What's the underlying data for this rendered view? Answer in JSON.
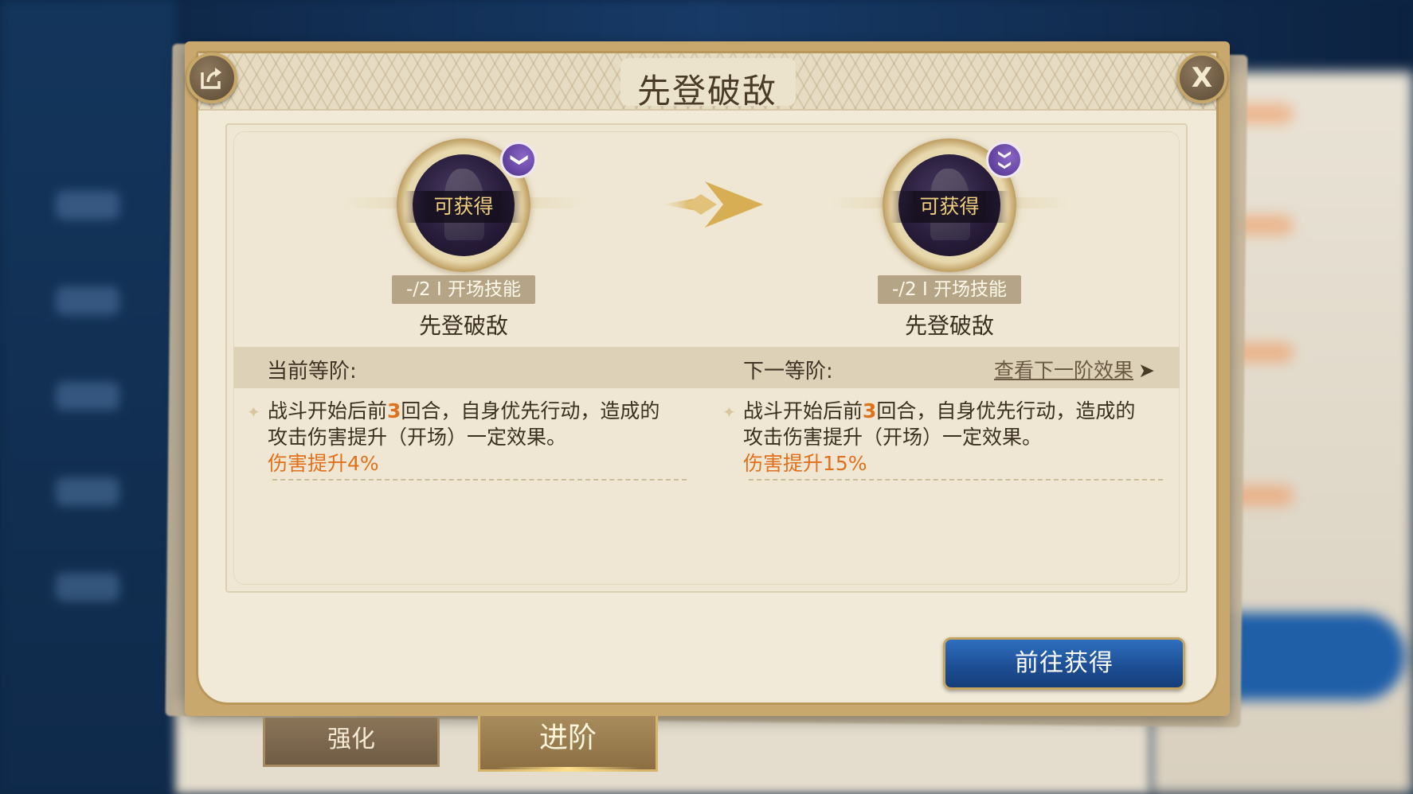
{
  "dialog": {
    "title": "先登破敌",
    "close_label": "X"
  },
  "icons": {
    "share": "share-icon",
    "close": "close-icon",
    "badge_single": "chevron-down-icon",
    "badge_double": "double-chevron-down-icon",
    "arrow": "arrow-right-icon"
  },
  "current_skill": {
    "status": "可获得",
    "badge": "❯",
    "tag": "-/2 I 开场技能",
    "name": "先登破敌"
  },
  "next_skill": {
    "status": "可获得",
    "badge": "❯❯",
    "tag": "-/2 I 开场技能",
    "name": "先登破敌"
  },
  "stage": {
    "current_label": "当前等阶:",
    "next_label": "下一等阶:",
    "view_next_link": "查看下一阶效果",
    "view_next_chevron": "➤"
  },
  "current_effect": {
    "line1_a": "战斗开始后前",
    "rounds": "3",
    "line1_b": "回合，自身优先行动，造成的",
    "line2": "攻击伤害提升（开场）一定效果。",
    "boost": "伤害提升4%"
  },
  "next_effect": {
    "line1_a": "战斗开始后前",
    "rounds": "3",
    "line1_b": "回合，自身优先行动，造成的",
    "line2": "攻击伤害提升（开场）一定效果。",
    "boost": "伤害提升15%"
  },
  "buttons": {
    "go_obtain": "前往获得"
  },
  "tabs": {
    "strengthen": "强化",
    "advance": "进阶",
    "active": "advance"
  },
  "colors": {
    "accent_orange": "#e0701c",
    "button_blue": "#1d4f95",
    "gold_border": "#c8a86c",
    "badge_purple": "#6a48a8"
  }
}
